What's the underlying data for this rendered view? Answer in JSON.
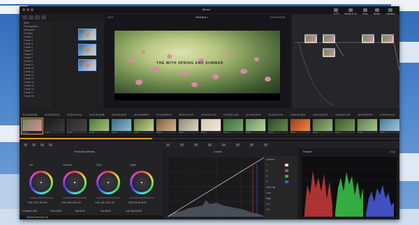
{
  "app": {
    "project_title": "Bloom",
    "viewer_title": "Timeline 1",
    "viewer_zoom": "24%",
    "viewer_timecode": "01:00:00:00",
    "viewer_timecode_bottom": "01:00:08:19",
    "brand": "DaVinci Resolve 18"
  },
  "top_right": {
    "items": [
      {
        "label": "LUTs",
        "icon": "luts-icon"
      },
      {
        "label": "Media Pool",
        "icon": "media-pool-icon"
      },
      {
        "label": "Clips",
        "icon": "clips-icon"
      },
      {
        "label": "Nodes",
        "icon": "nodes-icon"
      },
      {
        "label": "Lightbox",
        "icon": "lightbox-icon"
      }
    ]
  },
  "gallery": {
    "items": [
      "Stills",
      "Powergrades",
      "Memories",
      "Timeline",
      "Grade 1",
      "Grade 2",
      "Grade 3",
      "Grade 4",
      "Grade 5",
      "Grade 6",
      "Grade 7",
      "Grade 8",
      "Grade 9",
      "Grade 10",
      "Grade 11",
      "Grade 12",
      "Grade 13",
      "Grade 14",
      "Grade 15",
      "Grade 16",
      "Grade 17",
      "Grade 18"
    ]
  },
  "video": {
    "caption": "THE WITH SPRING AND SUMMER"
  },
  "timeline": {
    "clips": [
      {
        "num": "01  00:00:00:00",
        "label": "H.264"
      },
      {
        "num": "02  00:00:02:10",
        "label": "H.264"
      },
      {
        "num": "03  00:00:04:12",
        "label": "H.264"
      },
      {
        "num": "04  00:00:05:08",
        "label": "H.264"
      },
      {
        "num": "05  00:00:06:22",
        "label": "H.264"
      },
      {
        "num": "06  00:00:08:10",
        "label": "H.264"
      },
      {
        "num": "07  00:00:09:15",
        "label": "H.264"
      },
      {
        "num": "08  00:00:11:02",
        "label": "H.264"
      },
      {
        "num": "09  00:00:12:20",
        "label": "H.264"
      },
      {
        "num": "10  00:00:14:05",
        "label": "H.264"
      },
      {
        "num": "11  00:00:15:18",
        "label": "H.264"
      },
      {
        "num": "12  00:00:17:01",
        "label": "H.264"
      },
      {
        "num": "13  00:00:18:14",
        "label": "H.264"
      },
      {
        "num": "14  00:00:19:22",
        "label": "H.264"
      },
      {
        "num": "15  00:00:21:09",
        "label": "H.264"
      },
      {
        "num": "16  00:00:22:16",
        "label": "H.264"
      },
      {
        "num": "17  00:00:24:03",
        "label": "H.264"
      }
    ]
  },
  "wheels": {
    "header": "Primaries Wheels",
    "items": [
      {
        "label": "Lift",
        "values": "0.00  0.00  0.00  0.00"
      },
      {
        "label": "Gamma",
        "values": "0.00  0.00  0.00  0.00"
      },
      {
        "label": "Gain",
        "values": "1.00  1.00  1.00  1.00"
      },
      {
        "label": "Offset",
        "values": "25.00  25.00  25.00"
      }
    ],
    "footer": [
      "Contrast 1.000",
      "Pivot 0.435",
      "Sat 50.00",
      "Hue 50.00",
      "Lum Mix 100.00"
    ]
  },
  "curves": {
    "header": "Curves",
    "side_labels": [
      "Custom",
      "Y",
      "R",
      "G",
      "B",
      "Soft Clip",
      "Low",
      "High",
      "L.S.",
      "H.S."
    ]
  },
  "scope": {
    "header": "Parade",
    "zoom": "1 Up"
  },
  "colors": {
    "accent": "#e0a030",
    "selection": "#6aa6ff"
  }
}
